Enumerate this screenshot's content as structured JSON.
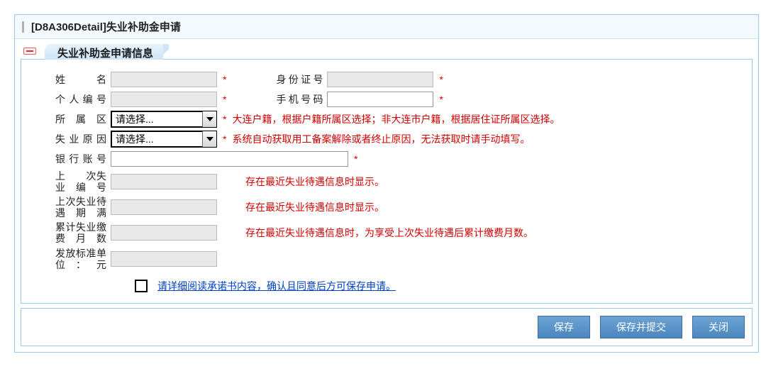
{
  "header": {
    "title": "[D8A306Detail]失业补助金申请"
  },
  "section": {
    "title": "失业补助金申请信息"
  },
  "labels": {
    "name": "姓　　名",
    "id_no": "身份证号",
    "person_no": "个人编号",
    "phone": "手机号码",
    "district": "所 属 区",
    "reason": "失业原因",
    "bank": "银行账号",
    "last_unemp_no": "上　　次失业编号",
    "last_unemp_end": "上次失业待遇期满",
    "accum_months": "累计失业缴费月数",
    "pay_std": "发放标准单位：元"
  },
  "values": {
    "name": "",
    "id_no": "",
    "person_no": "",
    "phone": "",
    "bank": "",
    "last_unemp_no": "",
    "last_unemp_end": "",
    "accum_months": "",
    "pay_std": ""
  },
  "selects": {
    "district_placeholder": "请选择...",
    "reason_placeholder": "请选择..."
  },
  "hints": {
    "district": "大连户籍，根据户籍所属区选择；非大连市户籍，根据居住证所属区选择。",
    "reason": "系统自动获取用工备案解除或者终止原因，无法获取时请手动填写。",
    "last_unemp_no": "存在最近失业待遇信息时显示。",
    "last_unemp_end": "存在最近失业待遇信息时显示。",
    "accum_months": "存在最近失业待遇信息时，为享受上次失业待遇后累计缴费月数。"
  },
  "star": "*",
  "commitment": {
    "text": "请详细阅读承诺书内容，确认且同意后方可保存申请。"
  },
  "buttons": {
    "save": "保存",
    "save_submit": "保存并提交",
    "close": "关闭"
  }
}
